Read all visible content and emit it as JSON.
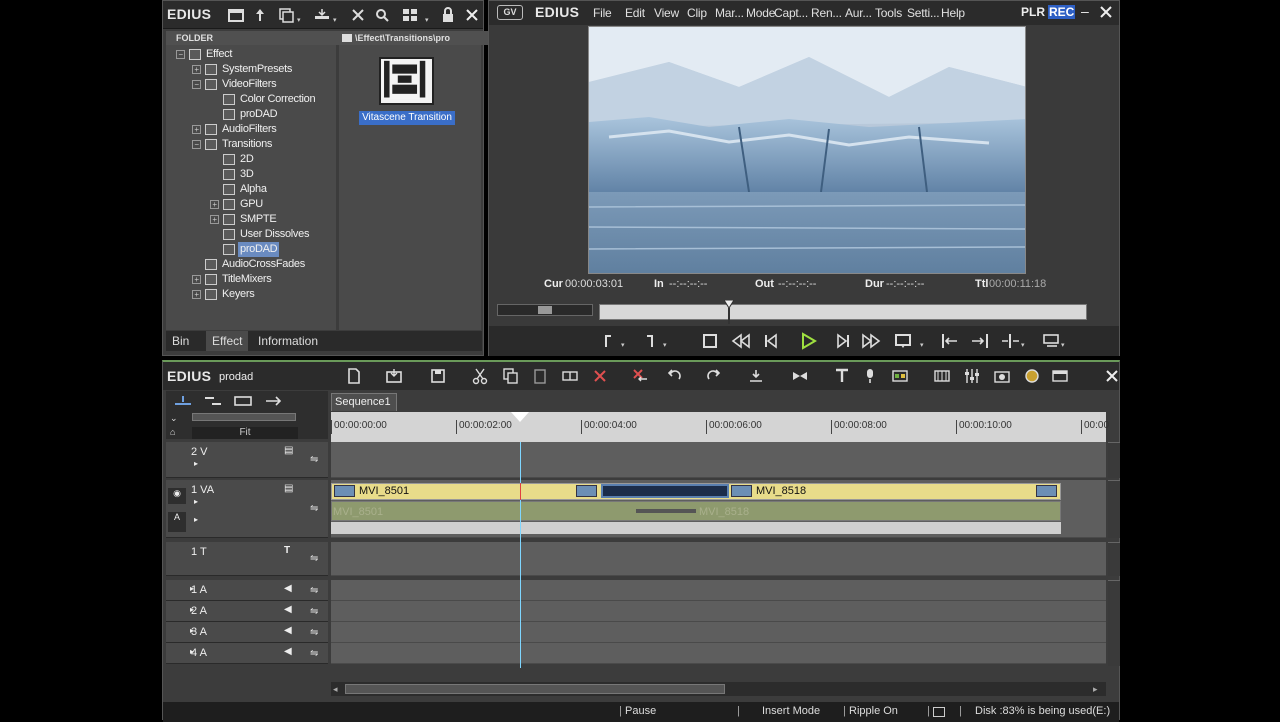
{
  "bin": {
    "logo": "EDIUS",
    "folder_header": "FOLDER",
    "path": "\\Effect\\Transitions\\pro",
    "tree": [
      {
        "label": "Effect",
        "level": 0,
        "expanded": true
      },
      {
        "label": "SystemPresets",
        "level": 1,
        "expanded": false
      },
      {
        "label": "VideoFilters",
        "level": 1,
        "expanded": true
      },
      {
        "label": "Color Correction",
        "level": 2,
        "expanded": null
      },
      {
        "label": "proDAD",
        "level": 2,
        "expanded": null
      },
      {
        "label": "AudioFilters",
        "level": 1,
        "expanded": false
      },
      {
        "label": "Transitions",
        "level": 1,
        "expanded": true
      },
      {
        "label": "2D",
        "level": 2,
        "expanded": null
      },
      {
        "label": "3D",
        "level": 2,
        "expanded": null
      },
      {
        "label": "Alpha",
        "level": 2,
        "expanded": null
      },
      {
        "label": "GPU",
        "level": 2,
        "expanded": false
      },
      {
        "label": "SMPTE",
        "level": 2,
        "expanded": false
      },
      {
        "label": "User Dissolves",
        "level": 2,
        "expanded": null
      },
      {
        "label": "proDAD",
        "level": 2,
        "expanded": null,
        "selected": true
      },
      {
        "label": "AudioCrossFades",
        "level": 1,
        "expanded": null
      },
      {
        "label": "TitleMixers",
        "level": 1,
        "expanded": false
      },
      {
        "label": "Keyers",
        "level": 1,
        "expanded": false
      }
    ],
    "item_label": "Vitascene Transition",
    "tabs": [
      "Bin",
      "Effect",
      "Information"
    ],
    "active_tab": "Effect"
  },
  "player": {
    "menu": [
      "File",
      "Edit",
      "View",
      "Clip",
      "Mar...",
      "Mode",
      "Capt...",
      "Ren...",
      "Aur...",
      "Tools",
      "Setti...",
      "Help"
    ],
    "logo": "EDIUS",
    "plr": "PLR",
    "rec": "REC",
    "timecodes": {
      "cur_label": "Cur",
      "cur": "00:00:03:01",
      "in_label": "In",
      "in": "--:--:--:--",
      "out_label": "Out",
      "out": "--:--:--:--",
      "dur_label": "Dur",
      "dur": "--:--:--:--",
      "ttl_label": "Ttl",
      "ttl": "00:00:11:18"
    },
    "scrub_position": 0.265
  },
  "timeline": {
    "logo": "EDIUS",
    "project": "prodad",
    "sequence_tab": "Sequence1",
    "zoom": "Fit",
    "ruler_ticks": [
      "00:00:00:00",
      "00:00:02:00",
      "00:00:04:00",
      "00:00:06:00",
      "00:00:08:00",
      "00:00:10:00",
      "00:00"
    ],
    "tracks": [
      {
        "name": "2 V",
        "type": "video"
      },
      {
        "name": "1 VA",
        "type": "va"
      },
      {
        "name": "1 T",
        "type": "title"
      },
      {
        "name": "1 A",
        "type": "audio"
      },
      {
        "name": "2 A",
        "type": "audio"
      },
      {
        "name": "3 A",
        "type": "audio"
      },
      {
        "name": "4 A",
        "type": "audio"
      }
    ],
    "clips": [
      {
        "name": "MVI_8501",
        "audio_name": "MVI_8501"
      },
      {
        "name": "MVI_8518",
        "audio_name": "MVI_8518"
      }
    ],
    "status": {
      "state": "Pause",
      "mode": "Insert Mode",
      "ripple": "Ripple On",
      "disk": "Disk :83% is being used(E:)"
    }
  }
}
